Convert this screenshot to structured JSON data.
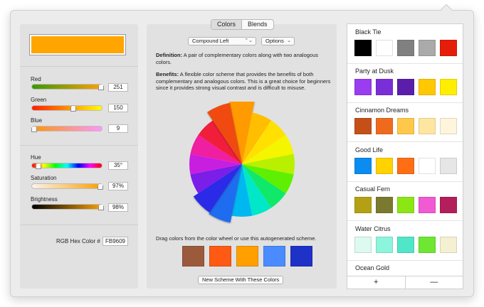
{
  "current_color": "#FFA500",
  "sliders": {
    "red": {
      "label": "Red",
      "value": "251",
      "fraction": 0.98
    },
    "green": {
      "label": "Green",
      "value": "150",
      "fraction": 0.59
    },
    "blue": {
      "label": "Blue",
      "value": "9",
      "fraction": 0.04
    },
    "hue": {
      "label": "Hue",
      "value": "35°",
      "fraction": 0.1
    },
    "saturation": {
      "label": "Saturation",
      "value": "97%",
      "fraction": 0.97
    },
    "brightness": {
      "label": "Brightness",
      "value": "98%",
      "fraction": 0.98
    }
  },
  "hex": {
    "label": "RGB Hex Color #",
    "value": "FB9609"
  },
  "tabs": {
    "colors": "Colors",
    "blends": "Blends"
  },
  "scheme_select": "Compound Left",
  "options_select": "Options",
  "definition": {
    "label": "Definition:",
    "text": "A pair of complementary colors along with two analogous colors."
  },
  "benefits": {
    "label": "Benefits:",
    "text": "A flexible color scheme that provides the benefits of both complementary and analogous colors. This is a great choice for beginners since it provides strong visual contrast and is difficult to misuse."
  },
  "wheel_colors": [
    "#ff9a00",
    "#ffbe00",
    "#ffe000",
    "#f5f500",
    "#b8f000",
    "#5ef000",
    "#10e86a",
    "#00e8c8",
    "#00b8f0",
    "#1e6cf0",
    "#2a2ae8",
    "#7a1ee8",
    "#c81ee0",
    "#f01ea0",
    "#f01e3a",
    "#f04a10"
  ],
  "drag_hint": "Drag colors from the color wheel or use this autogenerated scheme.",
  "scheme_colors": [
    "#9c5a3c",
    "#ff5a14",
    "#ffa000",
    "#4a8cff",
    "#1e32c8"
  ],
  "new_scheme_button": "New Scheme With These Colors",
  "palettes": [
    {
      "name": "Black Tie",
      "colors": [
        "#000000",
        "#ffffff",
        "#808080",
        "#aaaaaa",
        "#e41e0a"
      ]
    },
    {
      "name": "Party at Dusk",
      "colors": [
        "#9a3cf0",
        "#7a2ed8",
        "#5a1eaa",
        "#ffc800",
        "#ffee00"
      ]
    },
    {
      "name": "Cinnamon Dreams",
      "colors": [
        "#c45018",
        "#f06a1e",
        "#ffc84a",
        "#ffe6a0",
        "#fff5dc"
      ]
    },
    {
      "name": "Good Life",
      "colors": [
        "#0a8cf0",
        "#ffd200",
        "#ff6e14",
        "#ffffff",
        "#e6e6e6"
      ]
    },
    {
      "name": "Casual Fern",
      "colors": [
        "#b4a014",
        "#7a7a2e",
        "#8ce614",
        "#f05ad2",
        "#b41e5a"
      ]
    },
    {
      "name": "Water Citrus",
      "colors": [
        "#dcfaf0",
        "#8cf5dc",
        "#50e6c8",
        "#6ee632",
        "#f5f0d2"
      ]
    },
    {
      "name": "Ocean Gold",
      "colors": []
    }
  ],
  "footer": {
    "add": "+",
    "remove": "—"
  }
}
